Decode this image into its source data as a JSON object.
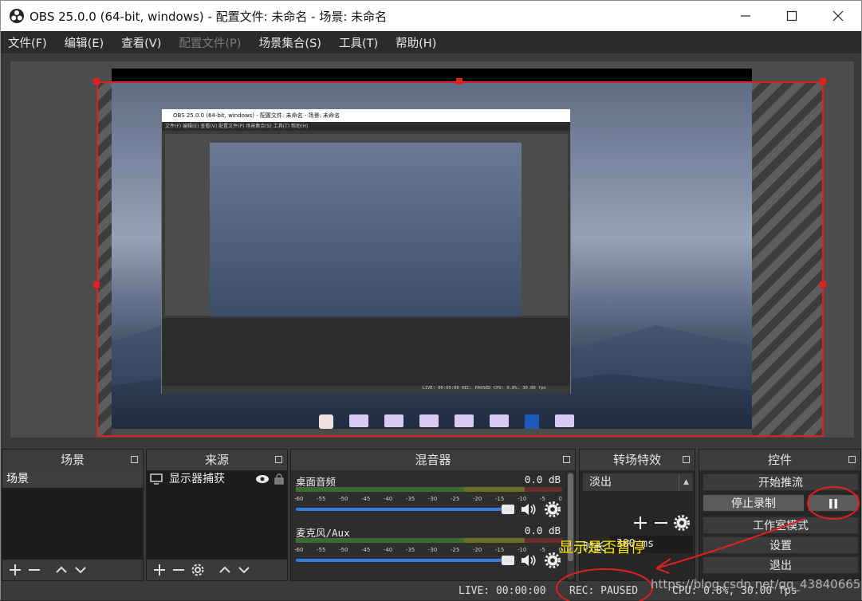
{
  "window": {
    "title": "OBS 25.0.0 (64-bit, windows) - 配置文件: 未命名 - 场景: 未命名",
    "minimize_icon": "minimize-icon",
    "maximize_icon": "maximize-icon",
    "close_icon": "close-icon"
  },
  "menu": [
    {
      "label": "文件(F)",
      "enabled": true
    },
    {
      "label": "编辑(E)",
      "enabled": true
    },
    {
      "label": "查看(V)",
      "enabled": true
    },
    {
      "label": "配置文件(P)",
      "enabled": false
    },
    {
      "label": "场景集合(S)",
      "enabled": true
    },
    {
      "label": "工具(T)",
      "enabled": true
    },
    {
      "label": "帮助(H)",
      "enabled": true
    }
  ],
  "preview": {
    "nested_title": "OBS 25.0.0 (64-bit, windows) - 配置文件: 未命名 - 场景: 未命名",
    "nested_menu": "文件(F)  编辑(E)  查看(V)  配置文件(P)  场景集合(S)  工具(T)  帮助(H)",
    "nested_status": "LIVE: 00:00:00   REC: PAUSED   CPU: 0.8%, 30.00 fps"
  },
  "docks": {
    "scenes": {
      "title": "场景",
      "items": [
        "场景"
      ]
    },
    "sources": {
      "title": "来源",
      "items": [
        {
          "label": "显示器捕获",
          "icon": "monitor-icon"
        }
      ]
    },
    "mixer": {
      "title": "混音器",
      "ticks": [
        "-60",
        "-55",
        "-50",
        "-45",
        "-40",
        "-35",
        "-30",
        "-25",
        "-20",
        "-15",
        "-10",
        "-5",
        "0"
      ],
      "tracks": [
        {
          "name": "桌面音频",
          "db": "0.0 dB",
          "level": 0.95
        },
        {
          "name": "麦克风/Aux",
          "db": "0.0 dB",
          "level": 0.95
        }
      ]
    },
    "transitions": {
      "title": "转场特效",
      "selected": "淡出",
      "duration_label": "时长",
      "duration_value": "300 ms"
    },
    "controls": {
      "title": "控件",
      "buttons": [
        "开始推流",
        "停止录制",
        "工作室模式",
        "设置",
        "退出"
      ],
      "pause_icon": "pause-icon"
    }
  },
  "status": {
    "live": "LIVE: 00:00:00",
    "rec": "REC: PAUSED",
    "cpu": "CPU: 0.8%, 30.00 fps"
  },
  "annotation": {
    "text": "显示是否暂停",
    "watermark": "https://blog.csdn.net/qq_43840665",
    "color": "#e02020"
  }
}
